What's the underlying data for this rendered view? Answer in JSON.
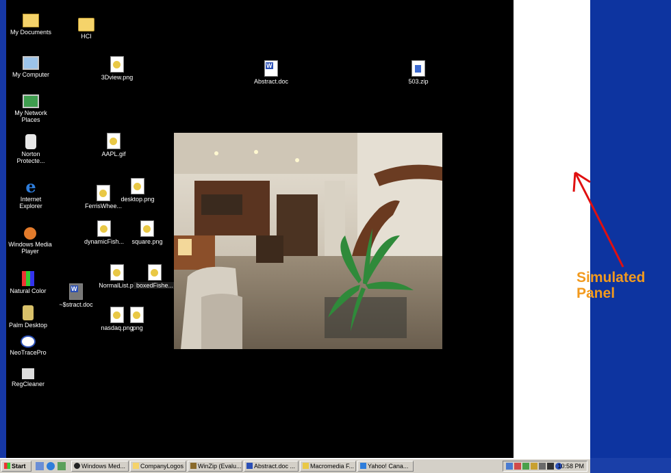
{
  "desktop": {
    "icons": {
      "my_documents": "My Documents",
      "hci": "HCI",
      "my_computer": "My Computer",
      "my_network_places": "My Network Places",
      "norton": "Norton Protecte...",
      "internet_explorer": "Internet Explorer",
      "windows_media_player": "Windows Media Player",
      "natural_color": "Natural Color",
      "palm_desktop": "Palm Desktop",
      "neotracepro": "NeoTracePro",
      "regcleaner": "RegCleaner",
      "threedview": "3Dview.png",
      "abstract_doc": "Abstract.doc",
      "zip_503": "503.zip",
      "aapl": "AAPL.gif",
      "desktop_png": "desktop.png",
      "ferris": "FerrisWhee...",
      "dynamic_fish": "dynamicFish...",
      "square_png": "square.png",
      "normal_list": "NormalList.pr",
      "boxed_fish": "boxedFishe...",
      "temp_abstract": "~$stract.doc",
      "nasdaq": "nasdaq.png",
      "png_tail": ".png"
    }
  },
  "panel": {
    "caption_line1": "Simulated",
    "caption_line2": "Panel",
    "caption_color": "#f29a1e",
    "arrow_color": "#e01010"
  },
  "taskbar": {
    "start_label": "Start",
    "buttons": [
      "Windows Med...",
      "CompanyLogos",
      "WinZip (Evalu...",
      "Abstract.doc ...",
      "Macromedia F...",
      "Yahoo! Cana..."
    ],
    "clock": "10:58 PM"
  }
}
